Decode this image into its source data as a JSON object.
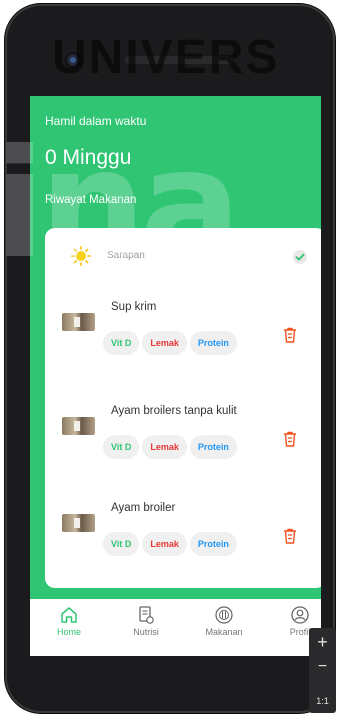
{
  "watermark": {
    "top_text": "UNIVERS",
    "overlay_text": "ina"
  },
  "hero": {
    "label": "Hamil dalam waktu",
    "value": "0 Minggu",
    "section_title": "Riwayat Makanan"
  },
  "meal": {
    "name": "Sarapan",
    "checked": true
  },
  "foods": [
    {
      "name": "Sup krim",
      "tags": [
        "Vit D",
        "Lemak",
        "Protein"
      ]
    },
    {
      "name": "Ayam broilers tanpa kulit",
      "tags": [
        "Vit D",
        "Lemak",
        "Protein"
      ]
    },
    {
      "name": "Ayam broiler",
      "tags": [
        "Vit D",
        "Lemak",
        "Protein"
      ]
    }
  ],
  "nav": {
    "items": [
      {
        "label": "Home",
        "icon": "home-icon",
        "active": true
      },
      {
        "label": "Nutrisi",
        "icon": "nutrition-icon",
        "active": false
      },
      {
        "label": "Makanan",
        "icon": "food-icon",
        "active": false
      },
      {
        "label": "Profil",
        "icon": "profile-icon",
        "active": false
      }
    ]
  },
  "zoom": {
    "plus": "+",
    "minus": "−",
    "reset": "1:1"
  },
  "colors": {
    "primary_green": "#2fc573",
    "lemak_red": "#e53935",
    "protein_blue": "#2196f3",
    "trash_orange": "#f4511e"
  }
}
